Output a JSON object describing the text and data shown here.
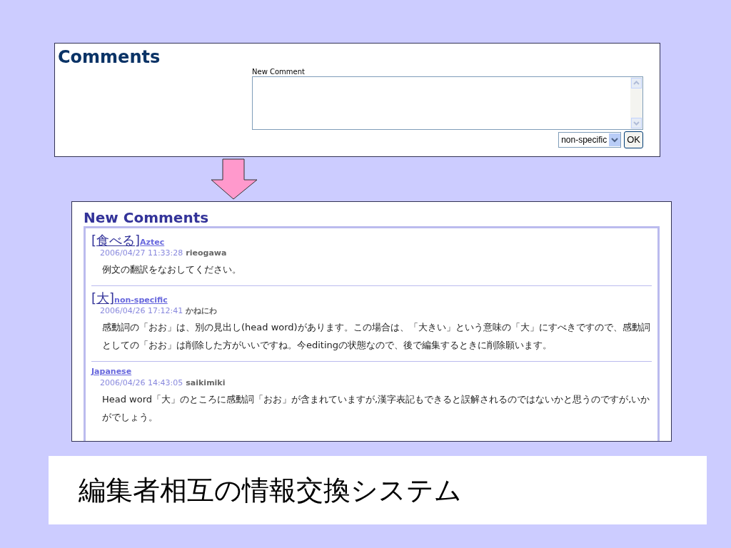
{
  "form_panel": {
    "title": "Comments",
    "field_label": "New Comment",
    "category_select": {
      "value": "non-specific"
    },
    "submit_button": "OK"
  },
  "comments_panel": {
    "title": "New Comments",
    "comments": [
      {
        "headword": "[食べる]",
        "language": "Aztec",
        "timestamp": "2006/04/27 11:33:28",
        "author": "rieogawa",
        "text": "例文の翻訳をなおしてください。"
      },
      {
        "headword": "[大]",
        "language": "non-specific",
        "timestamp": "2006/04/26 17:12:41",
        "author": "かねにわ",
        "text": "感動詞の「おお」は、別の見出し(head word)があります。この場合は、「大きい」という意味の「大」にすべきですので、感動詞としての「おお」は削除した方がいいですね。今editingの状態なので、後で編集するときに削除願います。"
      },
      {
        "language": "Japanese",
        "timestamp": "2006/04/26 14:43:05",
        "author": "saikimiki",
        "text": "Head word「大」のところに感動詞「おお」が含まれていますが,漢字表記もできると誤解されるのではないかと思うのですが,いかがでしょう。"
      }
    ]
  },
  "caption": "編集者相互の情報交換システム"
}
